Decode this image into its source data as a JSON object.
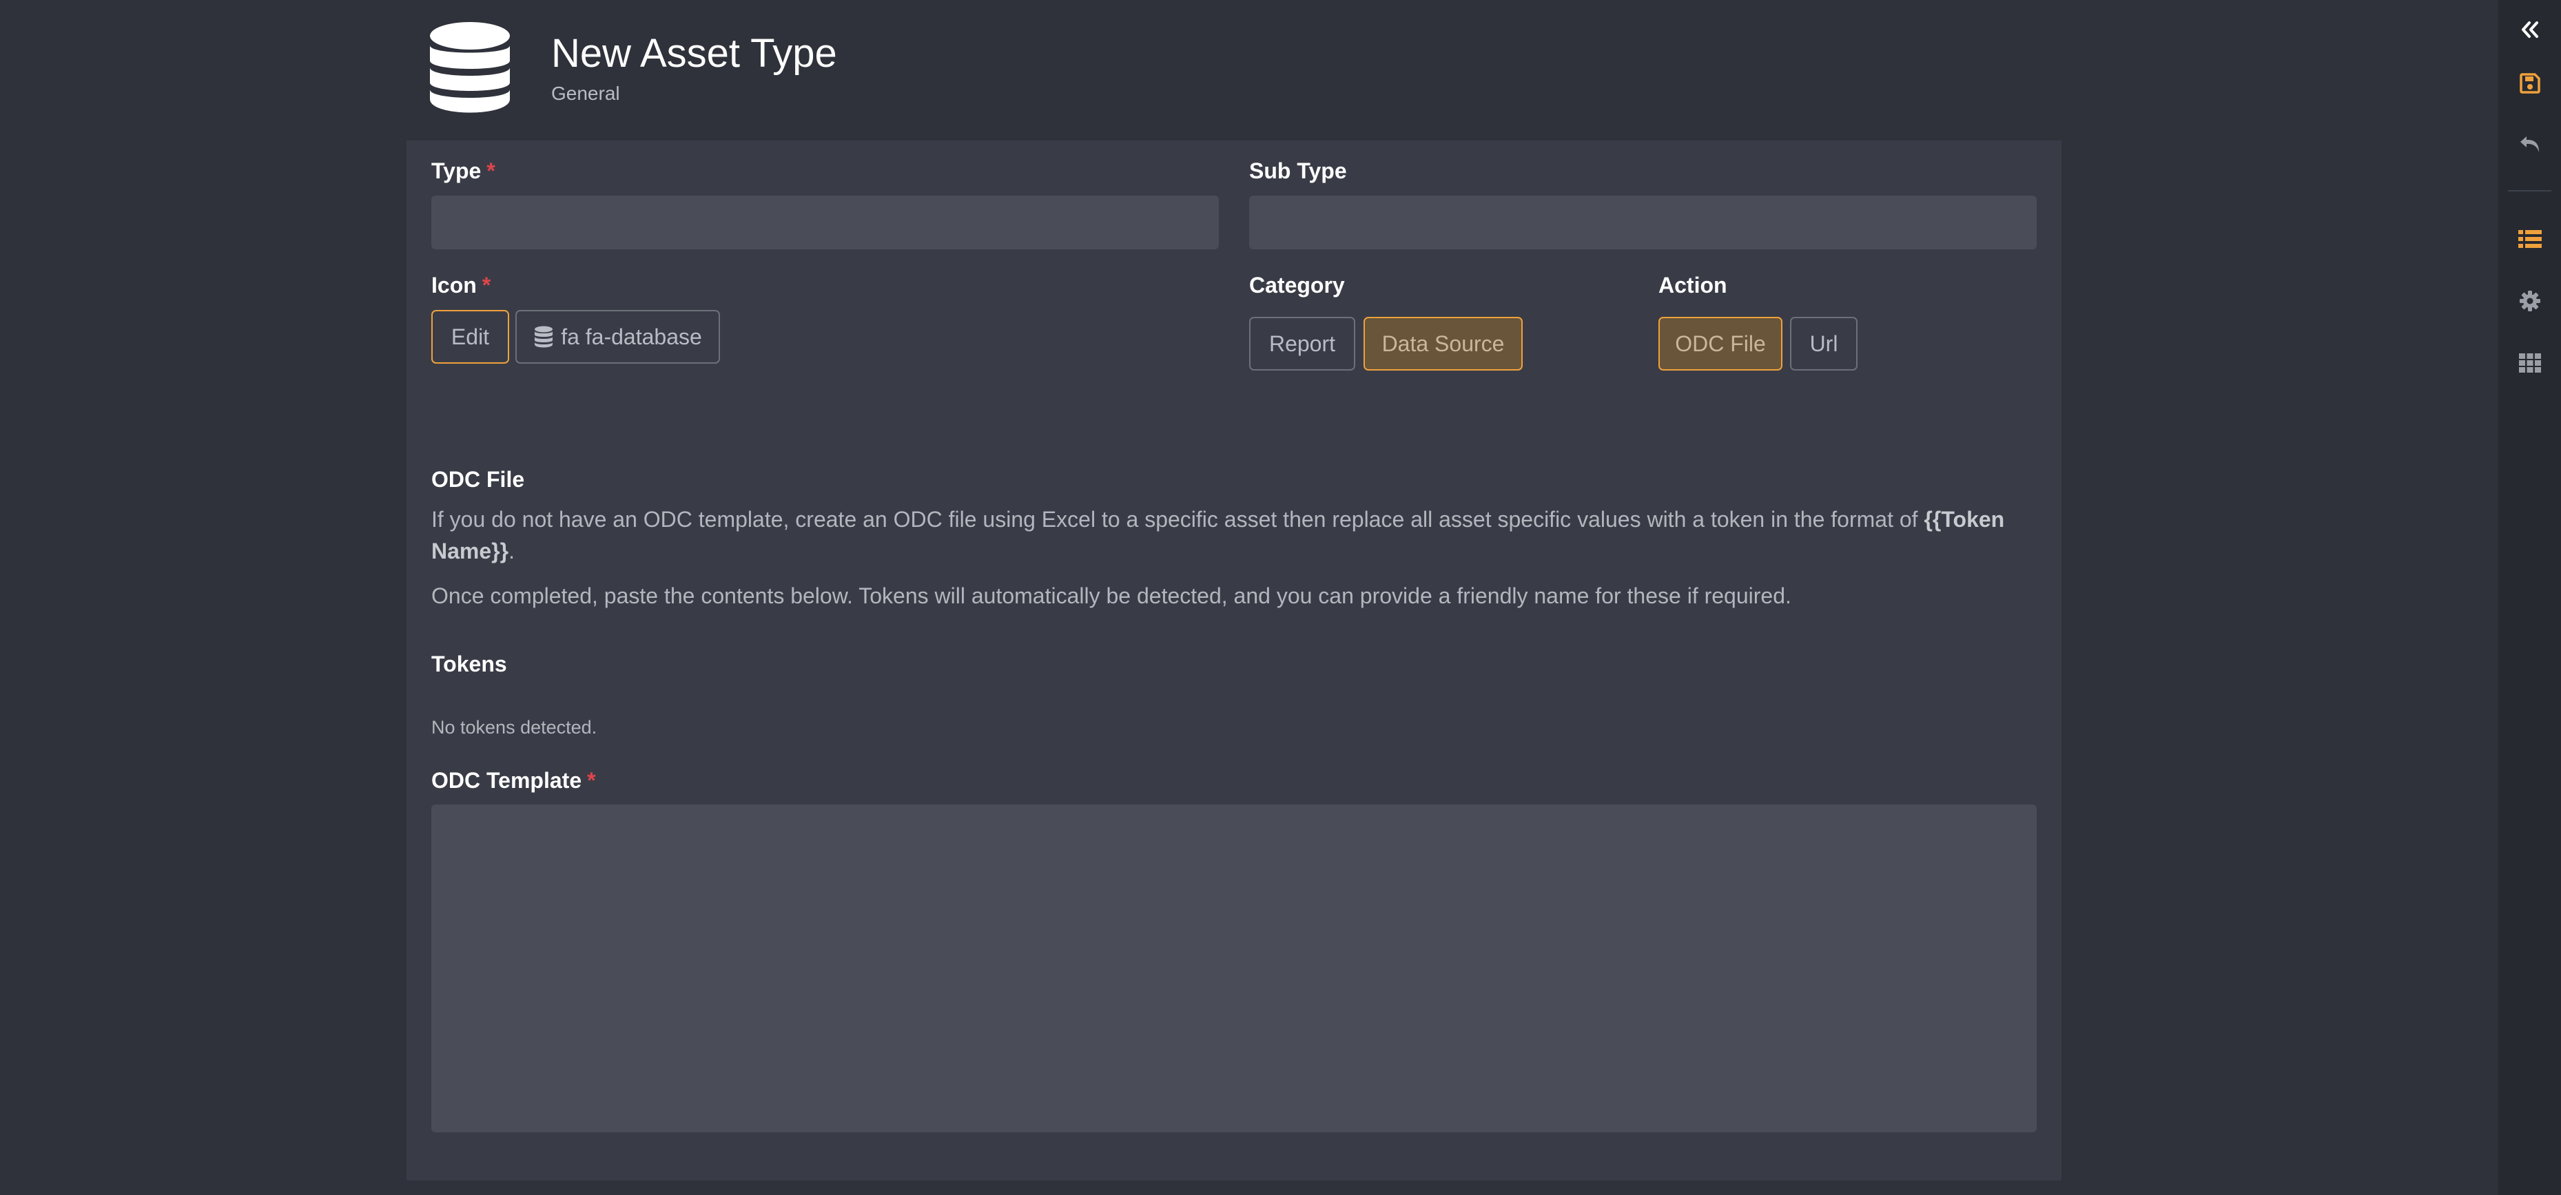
{
  "header": {
    "title": "New Asset Type",
    "subtitle": "General",
    "icon": "database-icon"
  },
  "form": {
    "type": {
      "label": "Type",
      "required_mark": "*",
      "value": ""
    },
    "sub_type": {
      "label": "Sub Type",
      "value": ""
    },
    "icon": {
      "label": "Icon",
      "required_mark": "*",
      "edit_label": "Edit",
      "current_value": "fa fa-database"
    },
    "category": {
      "label": "Category",
      "options": [
        "Report",
        "Data Source"
      ],
      "selected": "Data Source"
    },
    "action": {
      "label": "Action",
      "options": [
        "ODC File",
        "Url"
      ],
      "selected": "ODC File"
    },
    "odc_file": {
      "heading": "ODC File",
      "para1_text": "If you do not have an ODC template, create an ODC file using Excel to a specific asset then replace all asset specific values with a token in the format of ",
      "para1_token": "{{Token Name}}",
      "para1_end": ".",
      "para2": "Once completed, paste the contents below. Tokens will automatically be detected, and you can provide a friendly name for these if required."
    },
    "tokens": {
      "heading": "Tokens",
      "empty_text": "No tokens detected."
    },
    "odc_template": {
      "label": "ODC Template",
      "required_mark": "*",
      "value": ""
    }
  },
  "toolbar": {
    "items": [
      "collapse-icon",
      "save-icon",
      "undo-icon",
      "list-icon",
      "gear-icon",
      "grid-icon"
    ]
  },
  "colors": {
    "background": "#2f323b",
    "panel": "#393c46",
    "input": "#4a4d57",
    "accent": "#f0a13c",
    "required": "#e0454b",
    "toolbar": "#262930"
  }
}
